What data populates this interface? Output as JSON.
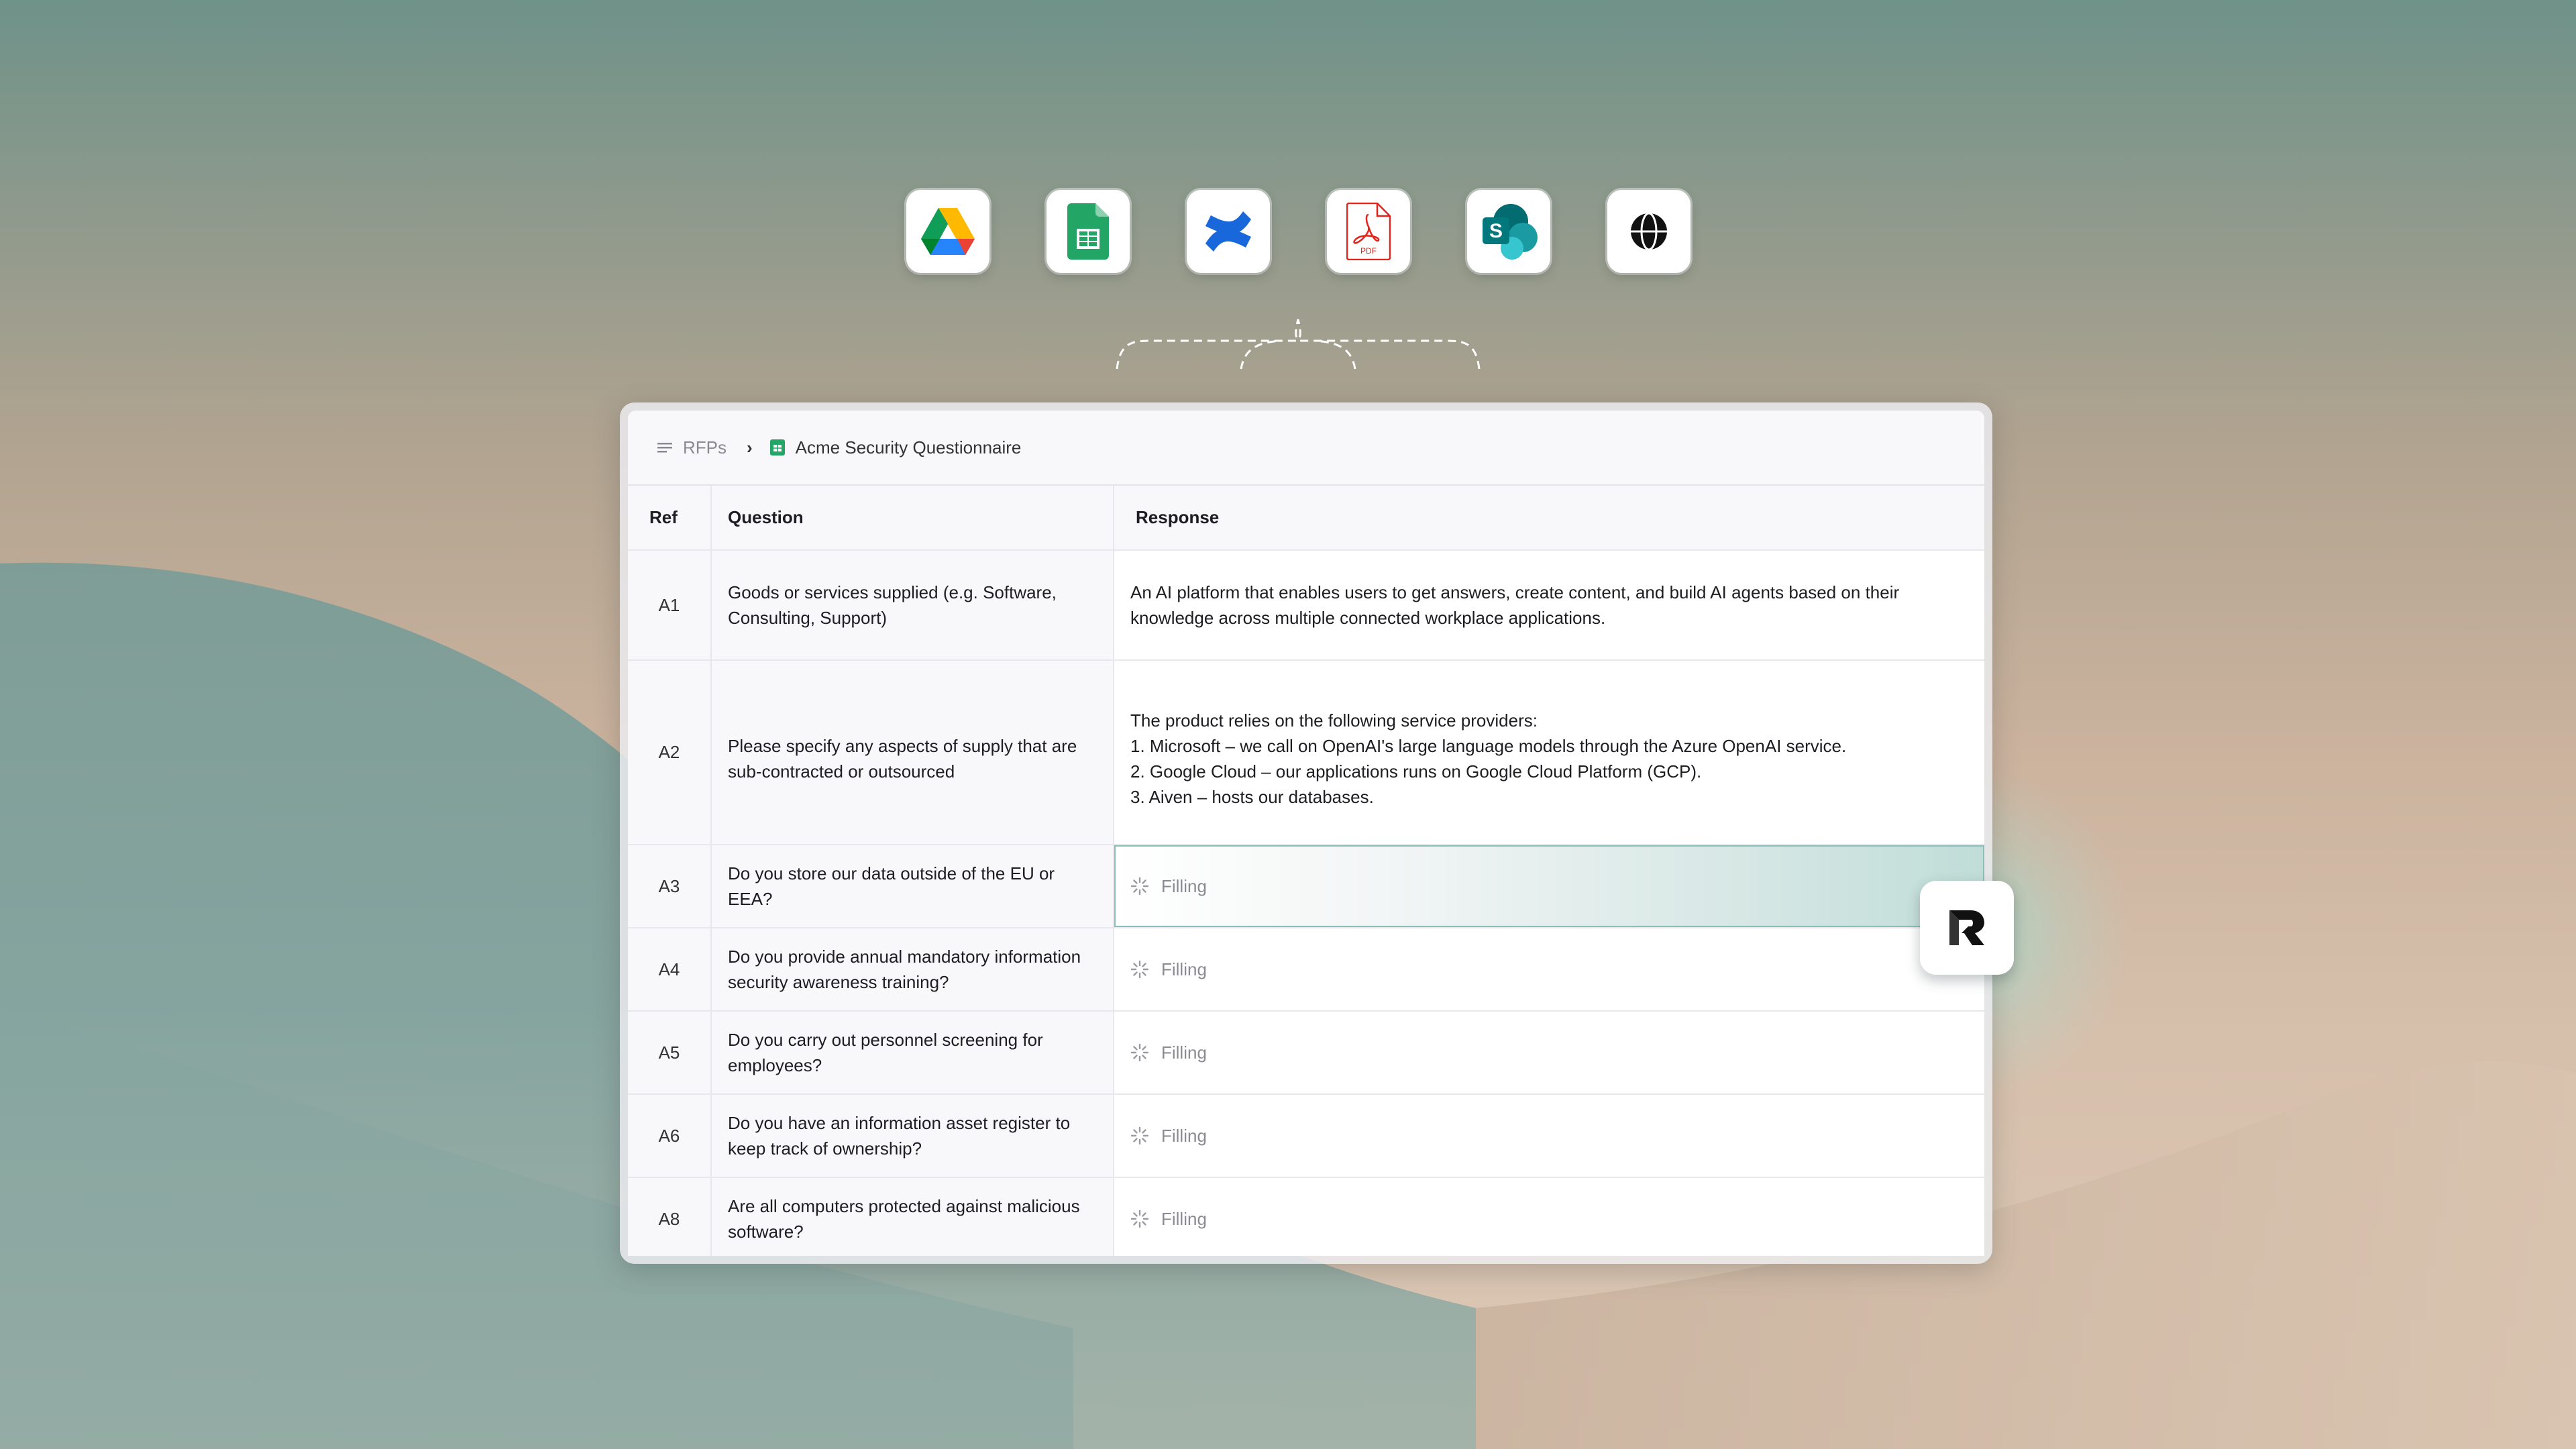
{
  "integrations": [
    {
      "name": "Google Drive",
      "icon": "google-drive-icon"
    },
    {
      "name": "Google Sheets",
      "icon": "google-sheets-icon"
    },
    {
      "name": "Confluence",
      "icon": "confluence-icon"
    },
    {
      "name": "PDF",
      "icon": "pdf-icon",
      "label": "PDF"
    },
    {
      "name": "SharePoint",
      "icon": "sharepoint-icon",
      "label": "S"
    },
    {
      "name": "Web",
      "icon": "globe-icon"
    }
  ],
  "breadcrumb": {
    "parent": "RFPs",
    "current": "Acme Security Questionnaire"
  },
  "table": {
    "headers": {
      "ref": "Ref",
      "question": "Question",
      "response": "Response"
    },
    "rows": [
      {
        "ref": "A1",
        "question": "Goods or services supplied (e.g. Software, Consulting, Support)",
        "response": "An AI platform that enables users to get answers, create content, and build AI agents based on their knowledge  across multiple connected workplace applications."
      },
      {
        "ref": "A2",
        "question": "Please specify any aspects of supply that are sub-contracted or outsourced",
        "response": "The product relies on the following service providers:\n1. Microsoft – we call on OpenAI's large language models through the Azure OpenAI service.\n2. Google Cloud – our applications runs on Google Cloud Platform (GCP).\n3. Aiven – hosts our databases."
      },
      {
        "ref": "A3",
        "question": "Do you store our data outside of the EU or EEA?",
        "response": "Filling"
      },
      {
        "ref": "A4",
        "question": "Do you provide annual mandatory information security awareness training?",
        "response": "Filling"
      },
      {
        "ref": "A5",
        "question": "Do you carry out personnel screening for employees?",
        "response": "Filling"
      },
      {
        "ref": "A6",
        "question": "Do you have an information asset register to keep track of ownership?",
        "response": "Filling"
      },
      {
        "ref": "A8",
        "question": "Are all computers protected against malicious software?",
        "response": "Filling"
      }
    ]
  },
  "colors": {
    "sheets_green": "#23a566",
    "active_outline": "#8cbfb8",
    "accent_glow": "#c0ddd8"
  }
}
